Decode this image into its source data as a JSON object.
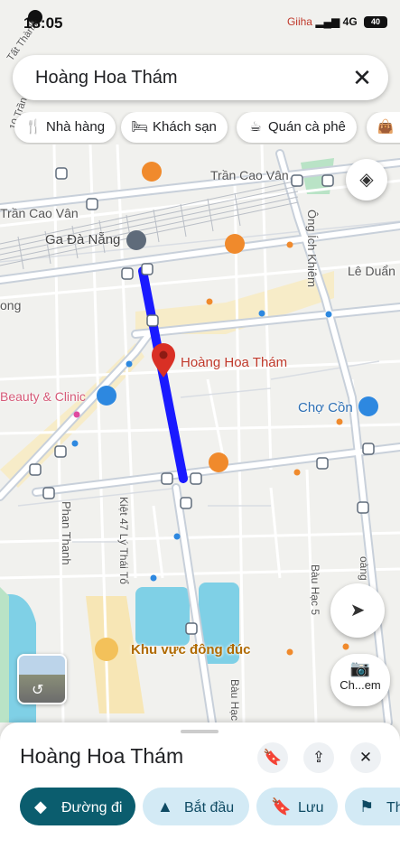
{
  "status": {
    "time": "18:05",
    "carrier": "Giiha",
    "network": "4G",
    "battery": "40"
  },
  "search": {
    "query": "Hoàng Hoa Thám",
    "clear": "✕"
  },
  "chips": [
    {
      "icon": "fork-knife-icon",
      "glyph": "🍴",
      "label": "Nhà hàng"
    },
    {
      "icon": "bed-icon",
      "glyph": "🛏",
      "label": "Khách sạn"
    },
    {
      "icon": "coffee-icon",
      "glyph": "☕",
      "label": "Quán cà phê"
    },
    {
      "icon": "bag-icon",
      "glyph": "👜",
      "label": ""
    }
  ],
  "map": {
    "labels": {
      "tran_cao_van_1": "Trần Cao Vân",
      "tran_cao_van_2": "Trần Cao Vân",
      "ga_da_nang": "Ga Đà Nẵng",
      "ong_ich_khiem": "Ông Ích Khiêm",
      "le_duan": "Lê Duẩn",
      "hoang_hoa_tham": "Hoàng Hoa Thám",
      "beauty_clinic": "Beauty & Clinic",
      "cho_con": "Chợ Cồn",
      "phan_thanh": "Phan Thanh",
      "kiet_47": "Kiệt 47 Lý Thái Tổ",
      "bau_hac_5": "Bàu Hạc 5",
      "bau_hac": "Bàu Hạc",
      "khu_vuc": "Khu vực đông đúc",
      "ong_fragment": "ong",
      "to_fragment": "10 Trần",
      "tat_thanh": "Tất Thành",
      "ly_fragment": "Lý",
      "oang": "oàng"
    }
  },
  "controls": {
    "layers": "layers-icon",
    "locate": "navigation-arrow-icon",
    "camera_label": "Ch...em"
  },
  "sheet": {
    "title": "Hoàng Hoa Thám",
    "actions": [
      {
        "icon": "directions-icon",
        "glyph": "◆",
        "label": "Đường đi",
        "primary": true
      },
      {
        "icon": "start-arrow-icon",
        "glyph": "▲",
        "label": "Bắt đầu"
      },
      {
        "icon": "bookmark-icon",
        "glyph": "🔖",
        "label": "Lưu"
      },
      {
        "icon": "flag-icon",
        "glyph": "⚑",
        "label": "Th"
      }
    ]
  },
  "colors": {
    "route": "#1a1aff",
    "pin": "#d93025",
    "primary_button": "#0b5d6e",
    "chip_action": "#d3eaf5"
  }
}
